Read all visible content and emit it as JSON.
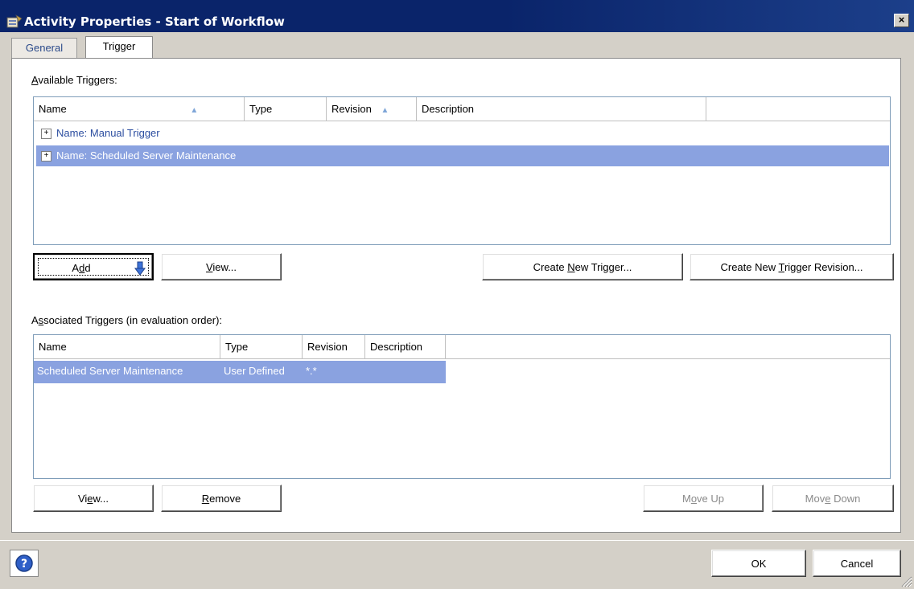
{
  "window": {
    "title": "Activity Properties - Start of Workflow",
    "close_label": "×"
  },
  "tabs": [
    {
      "label": "General"
    },
    {
      "label": "Trigger"
    }
  ],
  "available": {
    "label_prefix": "",
    "label_accel": "A",
    "label_rest": "vailable Triggers:",
    "columns": [
      "Name",
      "Type",
      "Revision",
      "Description"
    ],
    "items": [
      {
        "text": "Name: Manual Trigger",
        "selected": false
      },
      {
        "text": "Name: Scheduled Server Maintenance",
        "selected": true
      }
    ],
    "buttons": {
      "add_pre": "A",
      "add_accel": "d",
      "add_post": "d",
      "view_pre": "",
      "view_accel": "V",
      "view_post": "iew...",
      "create_pre": "Create ",
      "create_accel": "N",
      "create_post": "ew Trigger...",
      "revision_pre": "Create New ",
      "revision_accel": "T",
      "revision_post": "rigger Revision..."
    }
  },
  "associated": {
    "label_pre": "A",
    "label_accel": "s",
    "label_rest": "sociated Triggers (in evaluation order):",
    "columns": [
      "Name",
      "Type",
      "Revision",
      "Description"
    ],
    "rows": [
      {
        "name": "Scheduled Server Maintenance",
        "type": "User Defined",
        "revision": "*.*",
        "description": ""
      }
    ],
    "buttons": {
      "view_pre": "Vi",
      "view_accel": "e",
      "view_post": "w...",
      "remove_pre": "",
      "remove_accel": "R",
      "remove_post": "emove",
      "moveup_pre": "M",
      "moveup_accel": "o",
      "moveup_post": "ve Up",
      "movedown_pre": "Mov",
      "movedown_accel": "e",
      "movedown_post": " Down"
    }
  },
  "footer": {
    "ok_label": "OK",
    "cancel_label": "Cancel"
  }
}
